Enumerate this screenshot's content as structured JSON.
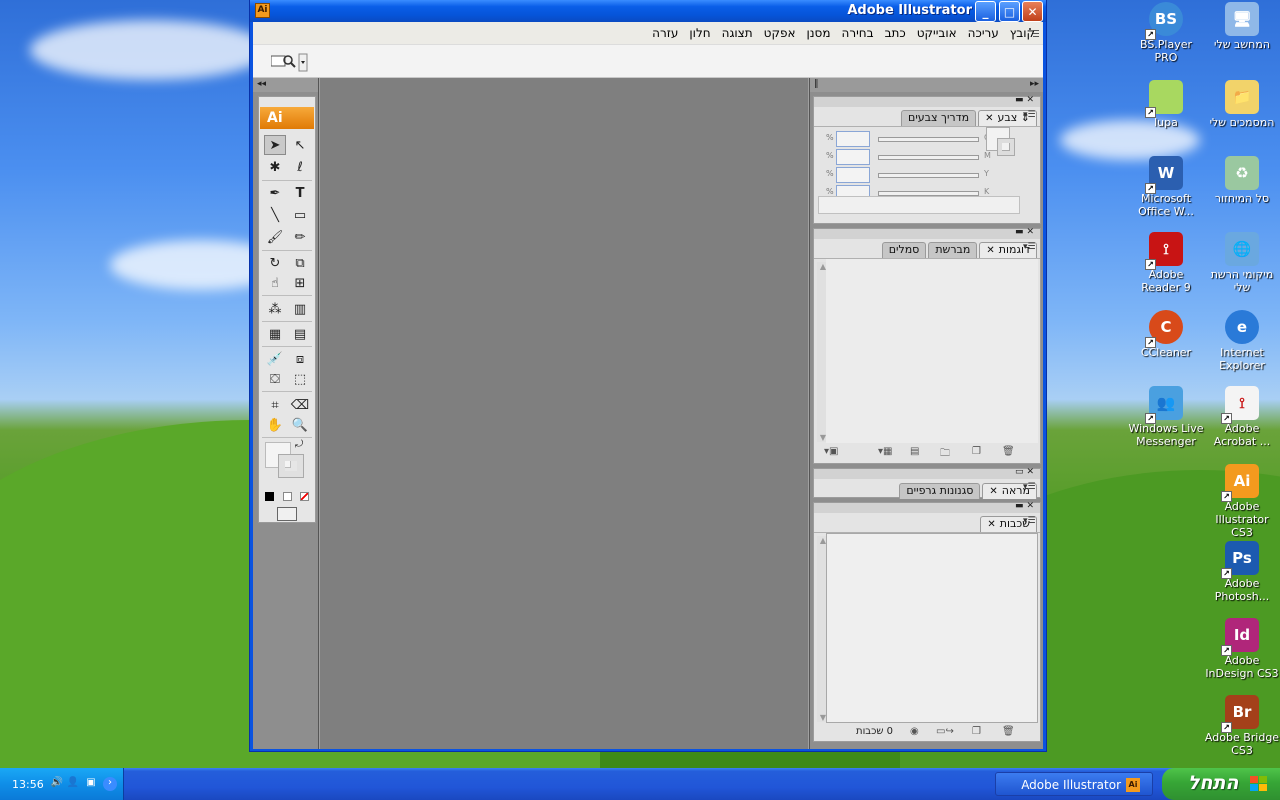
{
  "window": {
    "title": "Adobe Illustrator",
    "app_icon": "Ai",
    "buttons": {
      "minimize": "_",
      "maximize": "□",
      "close": "✕"
    }
  },
  "menu": [
    "קובץ",
    "עריכה",
    "אובייקט",
    "כתב",
    "בחירה",
    "מסנן",
    "אפקט",
    "תצוגה",
    "חלון",
    "עזרה"
  ],
  "toolbar": {
    "bridge_icon": "bridge-icon"
  },
  "tools_panel": {
    "logo": "Ai",
    "collapse_left": "◂◂",
    "collapse_right": "▸▸"
  },
  "color_panel": {
    "tabs": [
      {
        "label": "צבע",
        "active": true
      },
      {
        "label": "מדריך צבעים",
        "active": false
      }
    ],
    "sliders": [
      {
        "channel": "C",
        "unit": "%"
      },
      {
        "channel": "M",
        "unit": "%"
      },
      {
        "channel": "Y",
        "unit": "%"
      },
      {
        "channel": "K",
        "unit": "%"
      }
    ]
  },
  "swatches_panel": {
    "tabs": [
      {
        "label": "דוגמות",
        "active": true
      },
      {
        "label": "מברשת",
        "active": false
      },
      {
        "label": "סמלים",
        "active": false
      }
    ]
  },
  "appearance_panel": {
    "tabs": [
      {
        "label": "מראה",
        "active": true
      },
      {
        "label": "סגנונות גרפיים",
        "active": false
      }
    ]
  },
  "layers_panel": {
    "tabs": [
      {
        "label": "שכבות",
        "active": true
      }
    ],
    "count": "0 שכבות"
  },
  "desktop_icons": [
    {
      "label": "המחשב שלי",
      "icon": "my-computer-icon"
    },
    {
      "label": "BS.Player PRO",
      "icon": "bsplayer-icon",
      "glyph": "BS"
    },
    {
      "label": "המסמכים שלי",
      "icon": "my-documents-icon"
    },
    {
      "label": "lupa",
      "icon": "lupa-icon"
    },
    {
      "label": "סל המיחזור",
      "icon": "recycle-bin-icon"
    },
    {
      "label": "Microsoft Office W...",
      "icon": "word-icon",
      "glyph": "W"
    },
    {
      "label": "מיקומי הרשת שלי",
      "icon": "network-places-icon"
    },
    {
      "label": "Adobe Reader 9",
      "icon": "adobe-reader-icon"
    },
    {
      "label": "Internet Explorer",
      "icon": "internet-explorer-icon",
      "glyph": "e"
    },
    {
      "label": "CCleaner",
      "icon": "ccleaner-icon",
      "glyph": "C"
    },
    {
      "label": "Adobe Acrobat ...",
      "icon": "acrobat-icon"
    },
    {
      "label": "Windows Live Messenger",
      "icon": "messenger-icon"
    },
    {
      "label": "Adobe Illustrator CS3",
      "icon": "illustrator-icon",
      "glyph": "Ai"
    },
    {
      "label": "Adobe Photosh...",
      "icon": "photoshop-icon",
      "glyph": "Ps"
    },
    {
      "label": "Adobe InDesign CS3",
      "icon": "indesign-icon",
      "glyph": "Id"
    },
    {
      "label": "Adobe Bridge CS3",
      "icon": "bridge-icon",
      "glyph": "Br"
    }
  ],
  "taskbar": {
    "start_label": "התחל",
    "clock": "13:56",
    "task_label": "Adobe Illustrator",
    "task_icon": "Ai"
  },
  "colors": {
    "titlebar": "#0a5ee8",
    "ai_orange": "#f39a1e",
    "start_green": "#37a636",
    "taskbar_blue": "#2156d8"
  }
}
